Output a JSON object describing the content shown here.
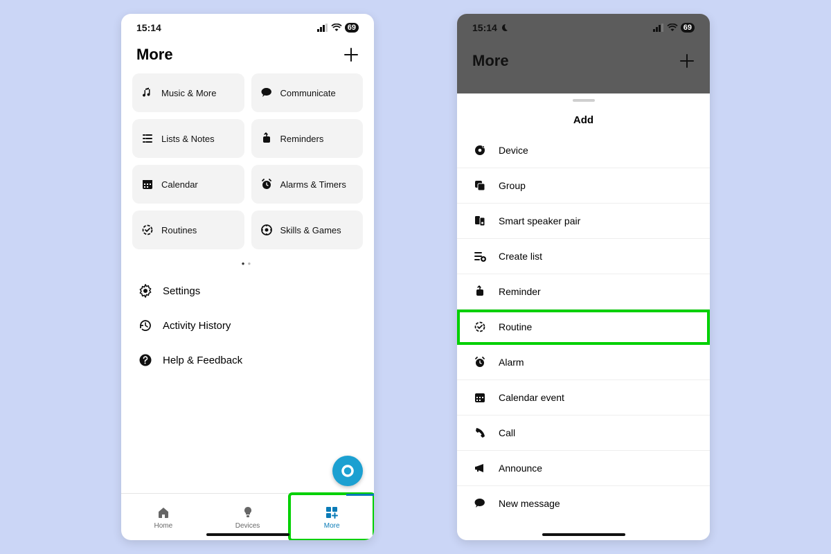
{
  "left": {
    "status": {
      "time": "15:14",
      "battery": "69"
    },
    "header": {
      "title": "More"
    },
    "tiles": [
      {
        "label": "Music & More"
      },
      {
        "label": "Communicate"
      },
      {
        "label": "Lists & Notes"
      },
      {
        "label": "Reminders"
      },
      {
        "label": "Calendar"
      },
      {
        "label": "Alarms & Timers"
      },
      {
        "label": "Routines"
      },
      {
        "label": "Skills & Games"
      }
    ],
    "menu": [
      {
        "label": "Settings"
      },
      {
        "label": "Activity History"
      },
      {
        "label": "Help & Feedback"
      }
    ],
    "tabs": [
      {
        "label": "Home"
      },
      {
        "label": "Devices"
      },
      {
        "label": "More"
      }
    ],
    "active_tab": 2
  },
  "right": {
    "status": {
      "time": "15:14",
      "battery": "69"
    },
    "header": {
      "title": "More"
    },
    "sheet_title": "Add",
    "items": [
      {
        "label": "Device"
      },
      {
        "label": "Group"
      },
      {
        "label": "Smart speaker pair"
      },
      {
        "label": "Create list"
      },
      {
        "label": "Reminder"
      },
      {
        "label": "Routine"
      },
      {
        "label": "Alarm"
      },
      {
        "label": "Calendar event"
      },
      {
        "label": "Call"
      },
      {
        "label": "Announce"
      },
      {
        "label": "New message"
      }
    ],
    "highlight_index": 5
  }
}
